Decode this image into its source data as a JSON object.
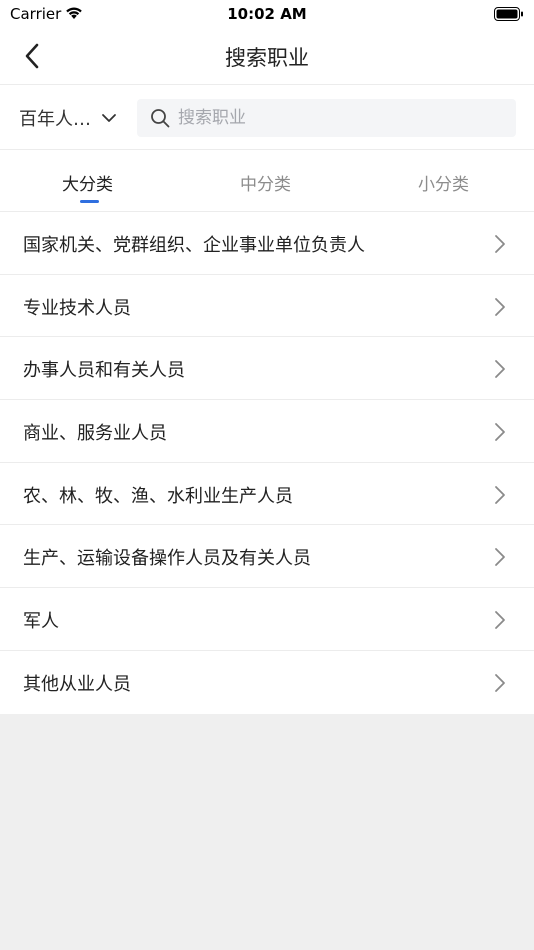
{
  "status_bar": {
    "carrier": "Carrier",
    "time": "10:02 AM"
  },
  "nav": {
    "title": "搜索职业"
  },
  "search": {
    "region_label": "百年人…",
    "placeholder": "搜索职业",
    "value": ""
  },
  "tabs": [
    {
      "label": "大分类",
      "active": true
    },
    {
      "label": "中分类",
      "active": false
    },
    {
      "label": "小分类",
      "active": false
    }
  ],
  "categories": [
    {
      "label": "国家机关、党群组织、企业事业单位负责人"
    },
    {
      "label": "专业技术人员"
    },
    {
      "label": "办事人员和有关人员"
    },
    {
      "label": "商业、服务业人员"
    },
    {
      "label": "农、林、牧、渔、水利业生产人员"
    },
    {
      "label": "生产、运输设备操作人员及有关人员"
    },
    {
      "label": "军人"
    },
    {
      "label": "其他从业人员"
    }
  ],
  "colors": {
    "accent": "#2f6fdf",
    "background": "#efefef",
    "divider": "#ececec",
    "inactive_tab": "#8c8c8c"
  },
  "icons": [
    "wifi-icon",
    "battery-icon",
    "back-chevron-icon",
    "chevron-down-icon",
    "search-icon",
    "chevron-right-icon"
  ]
}
